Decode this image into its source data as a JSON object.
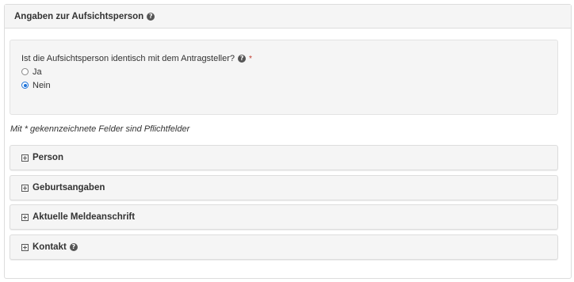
{
  "panel": {
    "title": "Angaben zur Aufsichtsperson",
    "help_icon": "question-circle-icon"
  },
  "question": {
    "label": "Ist die Aufsichtsperson identisch mit dem Antragsteller?",
    "required_marker": "*",
    "options": [
      {
        "label": "Ja",
        "checked": false
      },
      {
        "label": "Nein",
        "checked": true
      }
    ]
  },
  "required_note": "Mit * gekennzeichnete Felder sind Pflichtfelder",
  "sections": [
    {
      "label": "Person",
      "has_help": false,
      "icon": "plus-square-icon"
    },
    {
      "label": "Geburtsangaben",
      "has_help": false,
      "icon": "plus-square-icon"
    },
    {
      "label": "Aktuelle Meldeanschrift",
      "has_help": false,
      "icon": "plus-square-icon"
    },
    {
      "label": "Kontakt",
      "has_help": true,
      "icon": "plus-square-icon"
    }
  ],
  "colors": {
    "accent": "#1e73d8",
    "required": "#c0392b",
    "panel_bg": "#f5f5f5",
    "border": "#dddddd"
  }
}
